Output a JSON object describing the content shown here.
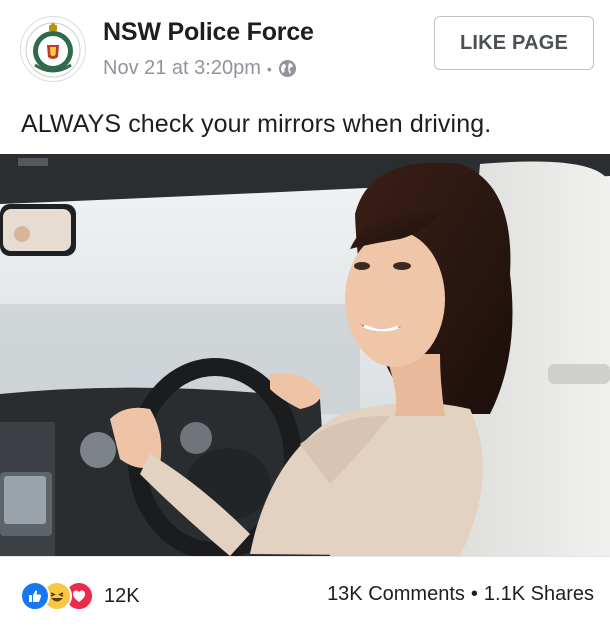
{
  "post": {
    "page_name": "NSW Police Force",
    "timestamp": "Nov 21 at 3:20pm",
    "separator": "•",
    "audience_icon": "globe-icon",
    "like_page_label": "LIKE PAGE",
    "caption": "ALWAYS check your mirrors when driving."
  },
  "footer": {
    "reaction_icons": [
      "like-icon",
      "haha-icon",
      "love-icon"
    ],
    "reaction_count": "12K",
    "comments": "13K Comments",
    "separator": "•",
    "shares": "1.1K Shares"
  },
  "colors": {
    "like_blue": "#1877f2",
    "haha_yellow": "#f7c843",
    "love_red": "#f0284a",
    "meta_gray": "#90949c",
    "button_border": "#bec3c9"
  }
}
